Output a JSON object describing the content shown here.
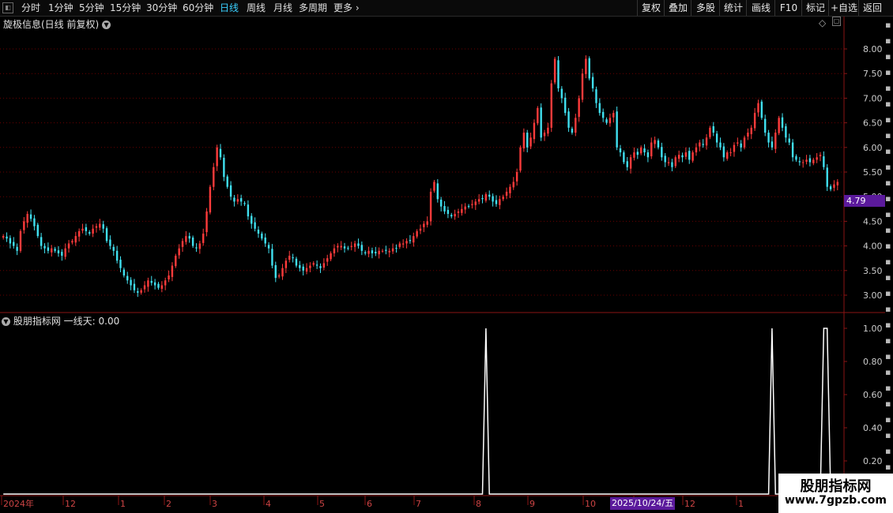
{
  "toolbar": {
    "tabs": [
      {
        "label": "分时",
        "active": false
      },
      {
        "label": "1分钟",
        "active": false
      },
      {
        "label": "5分钟",
        "active": false
      },
      {
        "label": "15分钟",
        "active": false
      },
      {
        "label": "30分钟",
        "active": false
      },
      {
        "label": "60分钟",
        "active": false
      },
      {
        "label": "日线",
        "active": true
      },
      {
        "label": "周线",
        "active": false
      },
      {
        "label": "月线",
        "active": false
      },
      {
        "label": "多周期",
        "active": false
      },
      {
        "label": "更多",
        "active": false
      }
    ],
    "buttons": [
      "复权",
      "叠加",
      "多股",
      "统计",
      "画线",
      "F10",
      "标记",
      "+自选",
      "返回"
    ]
  },
  "main_title": "旋极信息(日线 前复权)",
  "indicator_title": "股朋指标网 一线天: 0.00",
  "current_price_tag": "4.79",
  "cursor_date": "2025/10/24/五",
  "watermark": {
    "line1": "股朋指标网",
    "line2": "www.7gpzb.com"
  },
  "colors": {
    "up": "#ff3b3b",
    "down": "#40e0f0",
    "grid": "#6a0000",
    "axis": "#8a1414",
    "indicator": "#ffffff",
    "tag": "#5b1a9c"
  },
  "chart_data": [
    {
      "type": "candlestick",
      "ylim": [
        2.8,
        8.5
      ],
      "yticks": [
        "8.00",
        "7.50",
        "7.00",
        "6.50",
        "6.00",
        "5.50",
        "5.00",
        "4.50",
        "4.00",
        "3.50",
        "3.00"
      ],
      "xticks": [
        "2024年",
        "12",
        "1",
        "2",
        "3",
        "4",
        "5",
        "6",
        "7",
        "8",
        "9",
        "10",
        "11",
        "12",
        "1"
      ],
      "closes": [
        4.2,
        4.15,
        4.05,
        4.0,
        3.9,
        4.3,
        4.5,
        4.65,
        4.55,
        4.4,
        4.2,
        4.0,
        3.95,
        3.9,
        3.95,
        3.9,
        3.85,
        3.8,
        3.95,
        4.05,
        4.1,
        4.2,
        4.3,
        4.35,
        4.3,
        4.25,
        4.35,
        4.4,
        4.45,
        4.35,
        4.1,
        4.0,
        3.9,
        3.7,
        3.55,
        3.4,
        3.3,
        3.2,
        3.1,
        3.05,
        3.1,
        3.2,
        3.3,
        3.25,
        3.2,
        3.15,
        3.2,
        3.3,
        3.4,
        3.6,
        3.8,
        3.95,
        4.1,
        4.2,
        4.15,
        4.0,
        3.95,
        4.05,
        4.25,
        4.7,
        5.2,
        5.6,
        6.0,
        5.8,
        5.4,
        5.2,
        5.0,
        4.9,
        4.95,
        4.9,
        4.85,
        4.6,
        4.45,
        4.35,
        4.25,
        4.15,
        4.05,
        3.95,
        3.6,
        3.35,
        3.4,
        3.55,
        3.7,
        3.8,
        3.75,
        3.6,
        3.55,
        3.5,
        3.55,
        3.6,
        3.65,
        3.6,
        3.55,
        3.65,
        3.75,
        3.85,
        3.95,
        4.0,
        4.0,
        3.95,
        3.95,
        4.0,
        4.05,
        4.0,
        3.9,
        3.85,
        3.9,
        3.85,
        3.85,
        3.9,
        3.9,
        3.9,
        3.9,
        3.95,
        3.95,
        4.05,
        4.05,
        4.1,
        4.1,
        4.2,
        4.3,
        4.35,
        4.45,
        4.5,
        5.1,
        5.3,
        4.95,
        4.8,
        4.7,
        4.65,
        4.6,
        4.65,
        4.7,
        4.75,
        4.8,
        4.8,
        4.85,
        4.9,
        4.95,
        4.95,
        5.05,
        5.0,
        4.9,
        4.85,
        4.95,
        5.0,
        5.1,
        5.2,
        5.3,
        5.5,
        6.0,
        6.3,
        6.0,
        6.2,
        6.5,
        6.8,
        6.2,
        6.3,
        6.4,
        7.3,
        7.8,
        7.2,
        7.0,
        6.7,
        6.4,
        6.3,
        6.6,
        7.0,
        7.5,
        7.8,
        7.4,
        7.2,
        6.9,
        6.7,
        6.6,
        6.5,
        6.6,
        6.7,
        6.0,
        5.9,
        5.7,
        5.6,
        5.8,
        5.9,
        5.85,
        6.0,
        5.9,
        5.8,
        6.1,
        6.15,
        6.0,
        5.8,
        5.7,
        5.7,
        5.6,
        5.8,
        5.85,
        5.8,
        5.9,
        5.75,
        5.9,
        6.0,
        6.1,
        6.05,
        6.2,
        6.4,
        6.3,
        6.1,
        6.0,
        5.8,
        5.9,
        5.9,
        6.05,
        6.1,
        6.0,
        6.2,
        6.3,
        6.4,
        6.7,
        6.9,
        6.6,
        6.3,
        6.1,
        6.0,
        6.3,
        6.6,
        6.4,
        6.2,
        6.1,
        5.8,
        5.75,
        5.7,
        5.7,
        5.75,
        5.7,
        5.75,
        5.8,
        5.85,
        5.6,
        5.2,
        5.15,
        5.25,
        5.3
      ]
    },
    {
      "type": "line",
      "name": "一线天",
      "ylim": [
        0,
        1.05
      ],
      "yticks": [
        "1.00",
        "0.80",
        "0.60",
        "0.40",
        "0.20"
      ],
      "spikes": [
        {
          "x_index": 140,
          "value": 1.0
        },
        {
          "x_index": 223,
          "value": 1.0
        },
        {
          "x_index": 238,
          "value": 1.0
        },
        {
          "x_index": 239,
          "value": 1.0
        }
      ]
    }
  ]
}
